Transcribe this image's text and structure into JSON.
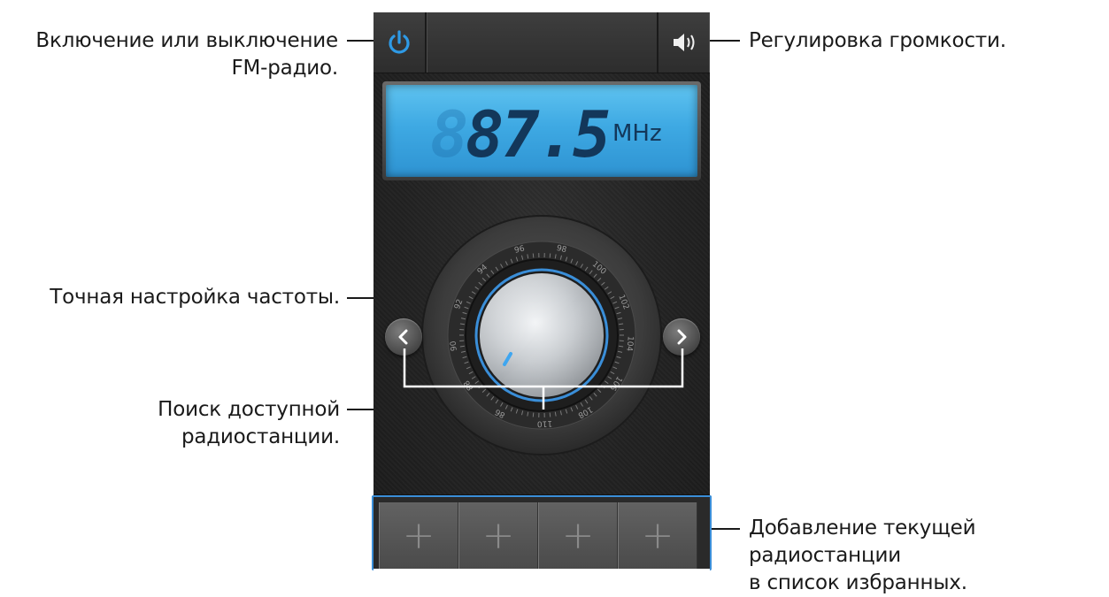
{
  "callouts": {
    "power": [
      "Включение или выключение",
      "FM-радио."
    ],
    "volume": "Регулировка громкости.",
    "fine_tune": "Точная настройка частоты.",
    "search": "Поиск доступной радиостанции.",
    "favorites": [
      "Добавление текущей радиостанции",
      "в список избранных."
    ]
  },
  "radio": {
    "frequency": "87.5",
    "frequency_ghost": "88",
    "unit": "MHz",
    "dial_ticks": [
      "86",
      "88",
      "90",
      "92",
      "94",
      "96",
      "98",
      "100",
      "102",
      "104",
      "106",
      "108",
      "110"
    ],
    "favorites": [
      "+",
      "+",
      "+",
      "+"
    ]
  },
  "icons": {
    "power": "power-icon",
    "volume": "speaker-icon",
    "prev": "chevron-left-icon",
    "next": "chevron-right-icon",
    "add": "plus-icon"
  },
  "colors": {
    "accent": "#3a8ed8",
    "lcd": "#3ea9e3",
    "lcd_text": "#13375a"
  }
}
